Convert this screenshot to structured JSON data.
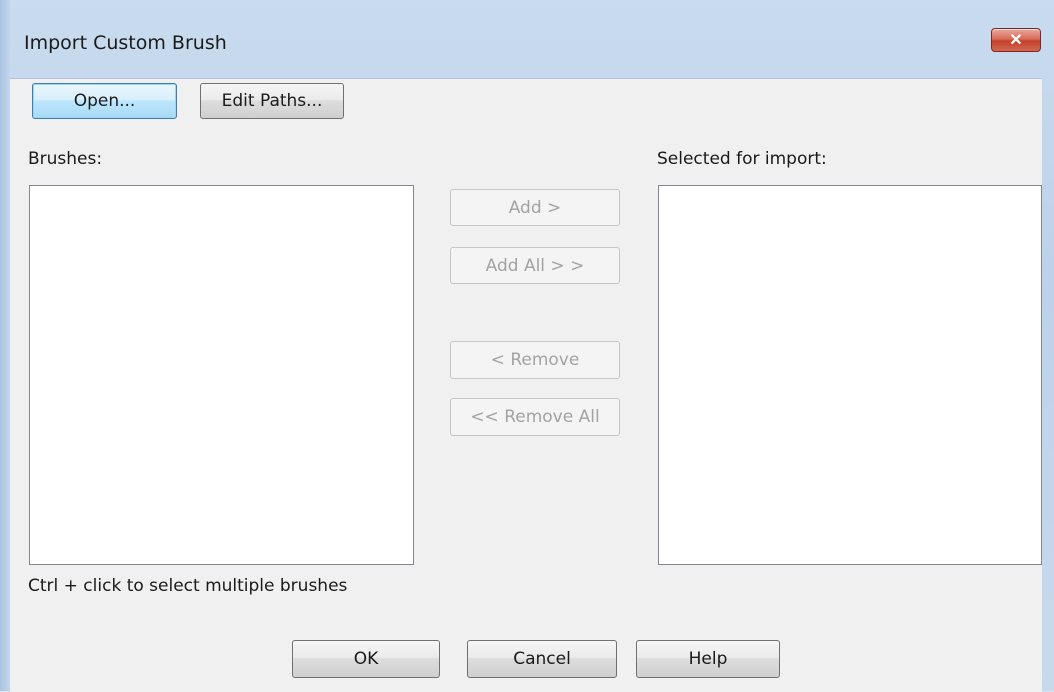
{
  "window": {
    "title": "Import Custom Brush",
    "close_label": "✕"
  },
  "toolbar": {
    "open_label": "Open...",
    "edit_paths_label": "Edit Paths..."
  },
  "brushes": {
    "label": "Brushes:",
    "items": [],
    "hint": "Ctrl + click to select multiple brushes"
  },
  "selected": {
    "label": "Selected for import:",
    "items": []
  },
  "transfer": {
    "add_label": "Add >",
    "add_all_label": "Add All > >",
    "remove_label": "< Remove",
    "remove_all_label": "<< Remove All"
  },
  "footer": {
    "ok_label": "OK",
    "cancel_label": "Cancel",
    "help_label": "Help"
  }
}
